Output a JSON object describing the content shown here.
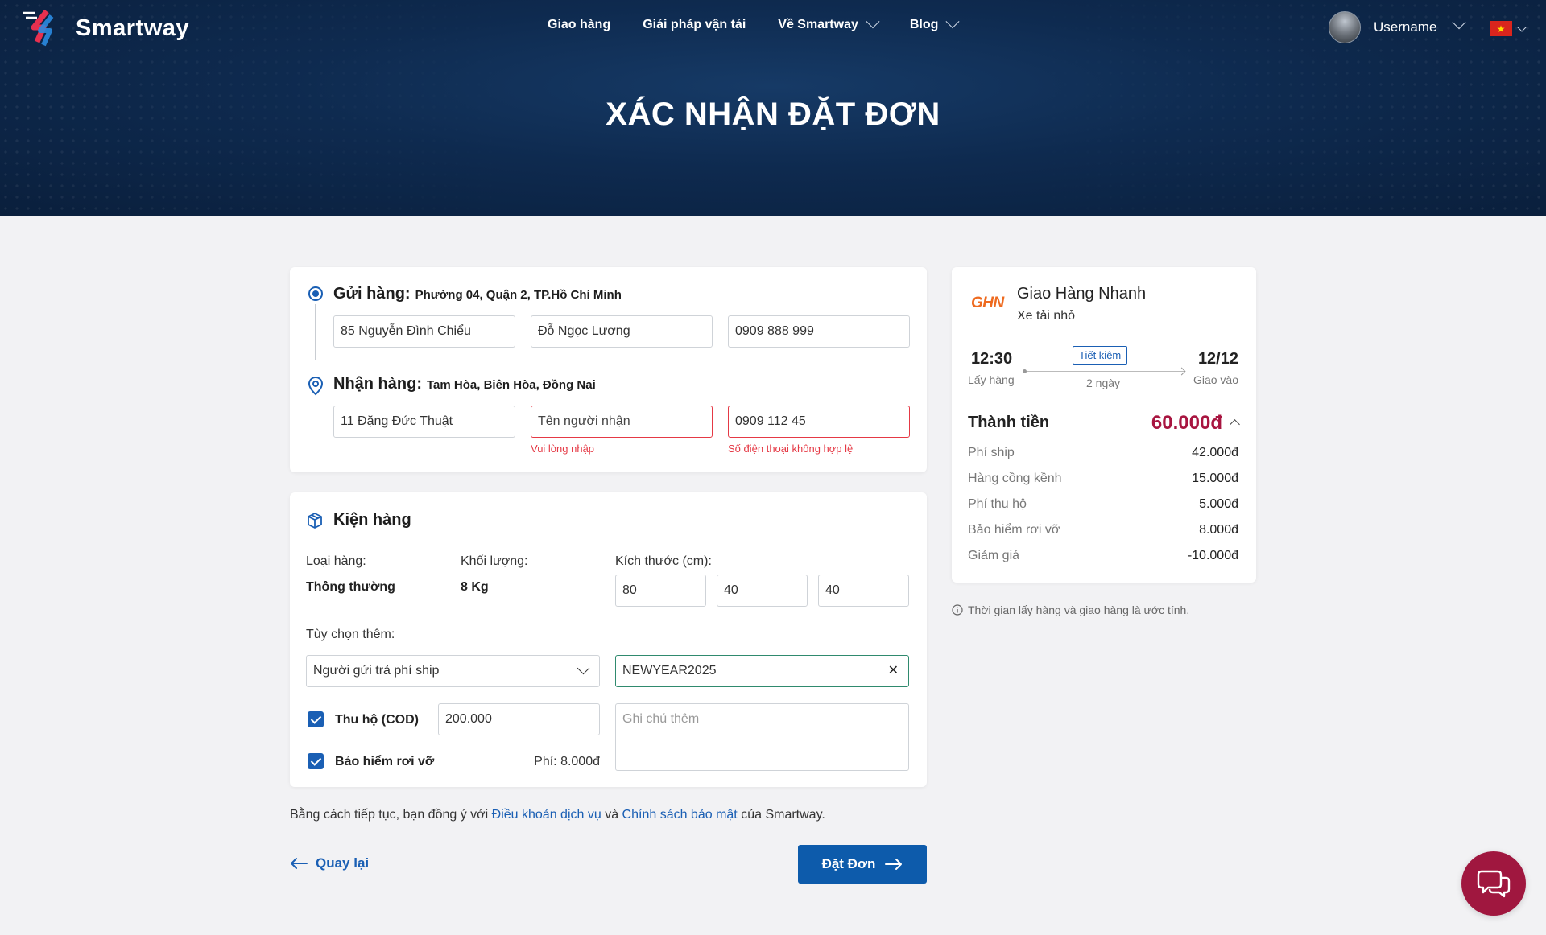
{
  "header": {
    "brand": "Smartway",
    "nav": [
      {
        "label": "Giao hàng"
      },
      {
        "label": "Giải pháp vận tải"
      },
      {
        "label": "Về Smartway"
      },
      {
        "label": "Blog"
      }
    ],
    "username": "Username",
    "flag_star": "★",
    "page_title": "XÁC NHẬN ĐẶT ĐƠN"
  },
  "sender": {
    "label": "Gửi hàng:",
    "area": "Phường 04, Quận 2, TP.Hồ Chí Minh",
    "address": "85 Nguyễn Đình Chiểu",
    "name": "Đỗ Ngọc Lương",
    "phone": "0909 888 999"
  },
  "receiver": {
    "label": "Nhận hàng:",
    "area": "Tam Hòa, Biên Hòa, Đồng Nai",
    "address": "11 Đặng Đức Thuật",
    "name_placeholder": "Tên người nhận",
    "name_error": "Vui lòng nhập",
    "phone": "0909 112 45",
    "phone_error": "Số điện thoại không hợp lệ"
  },
  "package": {
    "title": "Kiện hàng",
    "type_label": "Loại hàng:",
    "type_value": "Thông thường",
    "weight_label": "Khối lượng:",
    "weight_value": "8 Kg",
    "size_label": "Kích thước (cm):",
    "dims": [
      "80",
      "40",
      "40"
    ],
    "options_label": "Tùy chọn thêm:",
    "payer_select": "Người gửi trả phí ship",
    "promo_code": "NEWYEAR2025",
    "clear_symbol": "✕",
    "cod_label": "Thu hộ (COD)",
    "cod_value": "200.000",
    "note_placeholder": "Ghi chú thêm",
    "insurance_label": "Bảo hiểm rơi vỡ",
    "insurance_fee": "Phí: 8.000đ"
  },
  "terms": {
    "prefix": "Bằng cách tiếp tục, bạn đồng ý với ",
    "link1": "Điều khoản dịch vụ",
    "middle": " và ",
    "link2": "Chính sách bảo mật",
    "suffix": " của Smartway."
  },
  "actions": {
    "back": "Quay lại",
    "order": "Đặt Đơn"
  },
  "pricing": {
    "carrier_logo": "GHN",
    "carrier_name": "Giao Hàng Nhanh",
    "vehicle": "Xe tải nhỏ",
    "pickup_time": "12:30",
    "pickup_label": "Lấy hàng",
    "service_badge": "Tiết kiệm",
    "duration": "2 ngày",
    "delivery_date": "12/12",
    "delivery_label": "Giao vào",
    "total_label": "Thành tiền",
    "total_value": "60.000đ",
    "fees": [
      {
        "label": "Phí ship",
        "amount": "42.000đ"
      },
      {
        "label": "Hàng cồng kềnh",
        "amount": "15.000đ"
      },
      {
        "label": "Phí thu hộ",
        "amount": "5.000đ"
      },
      {
        "label": "Bảo hiểm rơi vỡ",
        "amount": "8.000đ"
      },
      {
        "label": "Giảm giá",
        "amount": "-10.000đ"
      }
    ],
    "note": "Thời gian lấy hàng và giao hàng là ước tính."
  },
  "colors": {
    "primary": "#0d5bab",
    "accent": "#a0173f",
    "error": "#e53945",
    "header_bg": "#0e2a4f"
  }
}
